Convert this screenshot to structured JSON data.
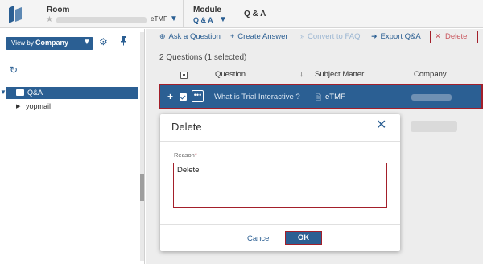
{
  "header": {
    "room_label": "Room",
    "room_value": "eTMF",
    "module_label": "Module",
    "module_value": "Q & A",
    "breadcrumb": "Q & A"
  },
  "sidebar": {
    "view_by_prefix": "View by",
    "view_by_value": "Company",
    "tree": {
      "root_label": "Q&A",
      "child_label": "yopmail"
    }
  },
  "toolbar": {
    "ask_question": "Ask a Question",
    "create_answer": "Create Answer",
    "convert_to_faq": "Convert to FAQ",
    "export_qa": "Export Q&A",
    "delete": "Delete"
  },
  "grid": {
    "count_text": "2 Questions (1 selected)",
    "columns": {
      "question": "Question",
      "subject_matter": "Subject Matter",
      "company": "Company"
    },
    "rows": [
      {
        "question": "What is Trial Interactive ?",
        "subject_matter": "eTMF",
        "selected": true
      }
    ]
  },
  "dialog": {
    "title": "Delete",
    "reason_label": "Reason",
    "reason_required_marker": "*",
    "reason_value": "Delete",
    "cancel_label": "Cancel",
    "ok_label": "OK"
  },
  "colors": {
    "primary": "#2b5f93",
    "highlight": "#a31f2a"
  }
}
